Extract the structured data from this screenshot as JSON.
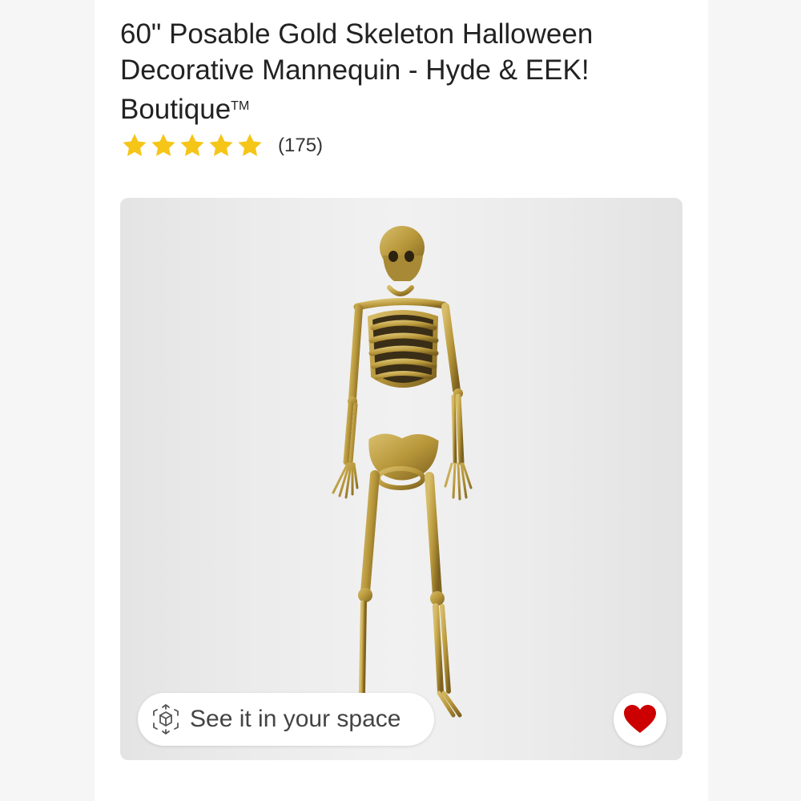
{
  "product": {
    "title": "60\" Posable Gold Skeleton Halloween Decorative Mannequin - Hyde & EEK! Boutique",
    "trademark": "TM"
  },
  "rating": {
    "stars": 5,
    "max_stars": 5,
    "count_label": "(175)"
  },
  "gallery": {
    "ar_button_label": "See it in your space",
    "ar_icon": "ar-cube-icon",
    "favorite_icon": "heart-icon"
  },
  "colors": {
    "star": "#f5c518",
    "heart": "#cc0000",
    "skeleton_gold": "#b8973a"
  }
}
